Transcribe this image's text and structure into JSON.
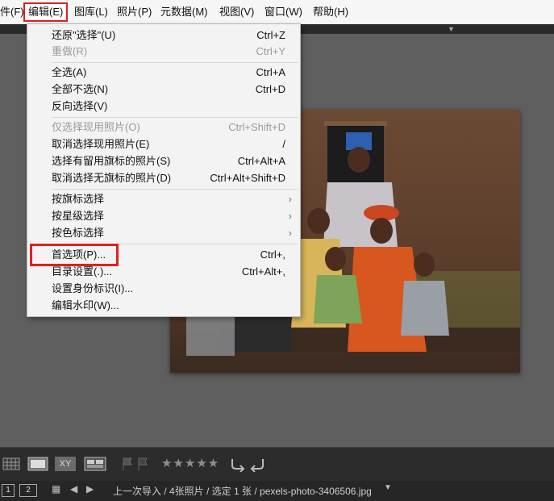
{
  "menubar": {
    "items": [
      "件(F)",
      "编辑(E)",
      "图库(L)",
      "照片(P)",
      "元数据(M)",
      "视图(V)",
      "窗口(W)",
      "帮助(H)"
    ]
  },
  "edit_menu": {
    "items": [
      {
        "label": "还原\"选择\"(U)",
        "shortcut": "Ctrl+Z",
        "disabled": false
      },
      {
        "label": "重做(R)",
        "shortcut": "Ctrl+Y",
        "disabled": true
      },
      {
        "label": "全选(A)",
        "shortcut": "Ctrl+A",
        "disabled": false
      },
      {
        "label": "全部不选(N)",
        "shortcut": "Ctrl+D",
        "disabled": false
      },
      {
        "label": "反向选择(V)",
        "shortcut": "",
        "disabled": false
      },
      {
        "label": "仅选择现用照片(O)",
        "shortcut": "Ctrl+Shift+D",
        "disabled": true
      },
      {
        "label": "取消选择现用照片(E)",
        "shortcut": "/",
        "disabled": false
      },
      {
        "label": "选择有留用旗标的照片(S)",
        "shortcut": "Ctrl+Alt+A",
        "disabled": false
      },
      {
        "label": "取消选择无旗标的照片(D)",
        "shortcut": "Ctrl+Alt+Shift+D",
        "disabled": false
      },
      {
        "label": "按旗标选择",
        "shortcut": "",
        "submenu": true
      },
      {
        "label": "按星级选择",
        "shortcut": "",
        "submenu": true
      },
      {
        "label": "按色标选择",
        "shortcut": "",
        "submenu": true
      },
      {
        "label": "首选项(P)...",
        "shortcut": "Ctrl+,",
        "disabled": false
      },
      {
        "label": "目录设置(.)...",
        "shortcut": "Ctrl+Alt+,",
        "disabled": false
      },
      {
        "label": "设置身份标识(I)...",
        "shortcut": "",
        "disabled": false
      },
      {
        "label": "编辑水印(W)...",
        "shortcut": "",
        "disabled": false
      }
    ]
  },
  "toolbar": {
    "rating_stars": "★★★★★"
  },
  "statusbar": {
    "page1": "1",
    "page2": "2",
    "text": "上一次导入 / 4张照片 / 选定 1 张 / pexels-photo-3406506.jpg"
  },
  "colors": {
    "highlight": "#e02020",
    "workspace": "#5f5f5f"
  }
}
